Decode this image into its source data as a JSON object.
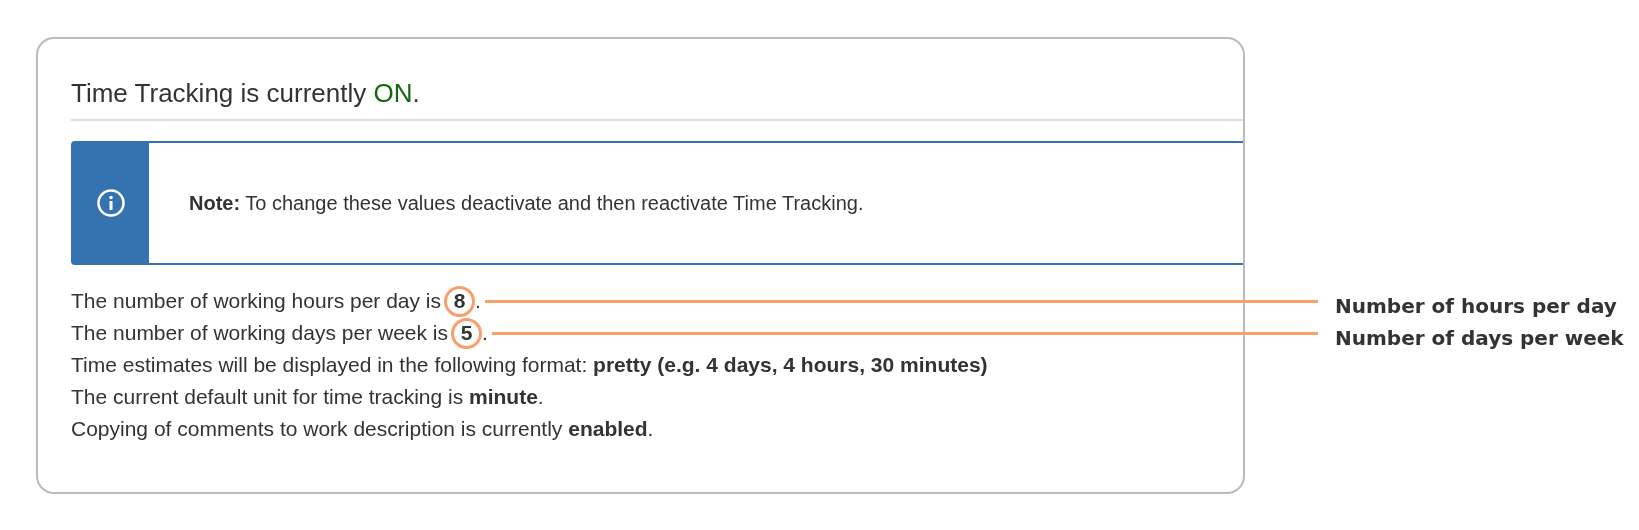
{
  "heading": {
    "text": "Time Tracking is currently",
    "status": "ON",
    "suffix": "."
  },
  "note": {
    "text": "**Note:** To change these values deactivate and then reactivate Time Tracking."
  },
  "lines": [
    {
      "kind": "callout",
      "text": "The number of working hours per day is",
      "value": "8",
      "suffix": ".",
      "callout": "Number of hours per day"
    },
    {
      "kind": "callout",
      "text": "The number of working days per week is",
      "value": "5",
      "suffix": ".",
      "callout": "Number of days per week"
    },
    {
      "kind": "plain",
      "text": "Time estimates will be displayed in the following format: **pretty (e.g. 4 days, 4 hours, 30 minutes)**"
    },
    {
      "kind": "plain",
      "text": "The current default unit for time tracking is **minute**."
    },
    {
      "kind": "plain",
      "text": "Copying of comments to work description is currently **enabled**."
    }
  ]
}
